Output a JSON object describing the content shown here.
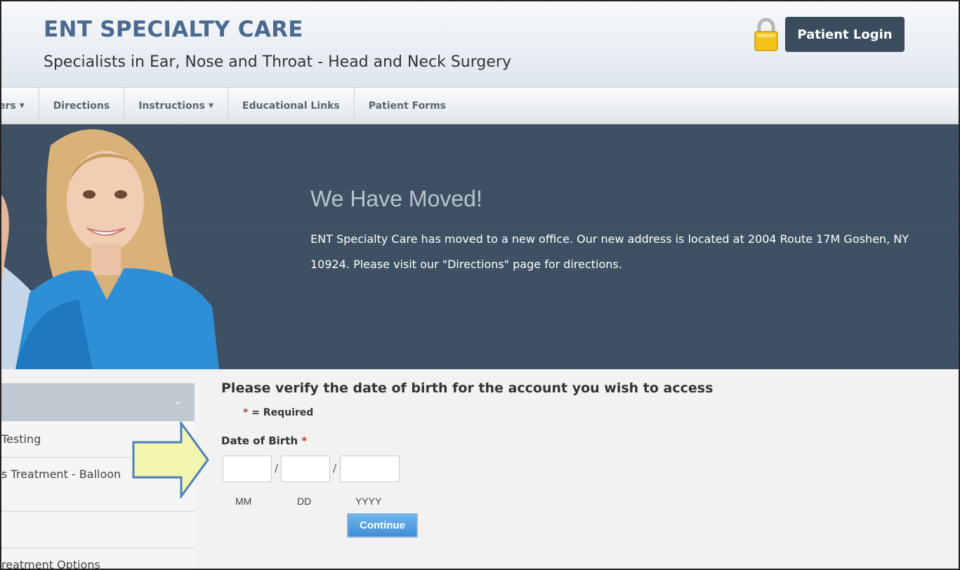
{
  "header": {
    "title": "ENT SPECIALTY CARE",
    "subtitle": "Specialists in Ear, Nose and Throat - Head and Neck Surgery",
    "login_label": "Patient Login"
  },
  "nav": {
    "items": [
      {
        "label": "ers"
      },
      {
        "label": "Directions"
      },
      {
        "label": "Instructions"
      },
      {
        "label": "Educational Links"
      },
      {
        "label": "Patient Forms"
      }
    ]
  },
  "banner": {
    "title": "We Have Moved!",
    "text": "ENT Specialty Care has moved to a new office. Our new address is located at 2004 Route 17M Goshen, NY 10924. Please visit our \"Directions\" page for directions."
  },
  "sidebar": {
    "items": [
      {
        "label": "Testing"
      },
      {
        "label": "s Treatment - Balloon"
      },
      {
        "label": ""
      },
      {
        "label": "reatment Options"
      }
    ]
  },
  "form": {
    "title": "Please verify the date of birth for the account you wish to access",
    "required_star": "*",
    "required_note": "= Required",
    "dob_label": "Date of Birth",
    "separator": "/",
    "mm_hint": "MM",
    "dd_hint": "DD",
    "yyyy_hint": "YYYY",
    "continue_label": "Continue"
  },
  "colors": {
    "brand_title": "#4a6a8f",
    "login_button": "#3b4c5e",
    "banner_bg": "#3d4f63",
    "continue_button": "#3f8fd6",
    "required_star": "#c0392b",
    "arrow_fill": "#f2f5b0"
  }
}
